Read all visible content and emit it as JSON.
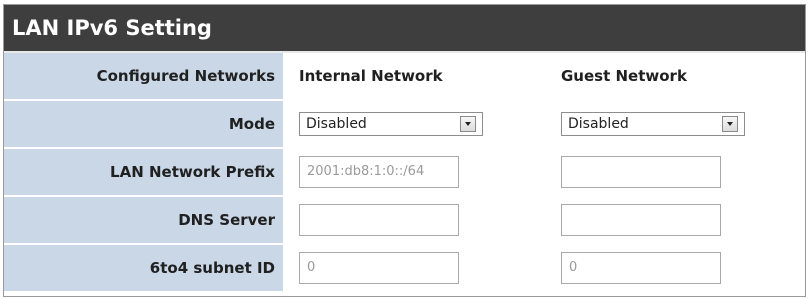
{
  "title": "LAN IPv6 Setting",
  "columns": {
    "configured_label": "Configured Networks",
    "internal": "Internal Network",
    "guest": "Guest Network"
  },
  "rows": {
    "mode": {
      "label": "Mode",
      "internal_value": "Disabled",
      "guest_value": "Disabled"
    },
    "prefix": {
      "label": "LAN Network Prefix",
      "internal_value": "2001:db8:1:0::/64",
      "guest_value": ""
    },
    "dns": {
      "label": "DNS Server",
      "internal_value": "",
      "guest_value": ""
    },
    "subnet": {
      "label": "6to4 subnet ID",
      "internal_value": "0",
      "guest_value": "0"
    }
  },
  "colors": {
    "header_bg": "#3e3e3e",
    "label_bg": "#c9d7e7"
  }
}
